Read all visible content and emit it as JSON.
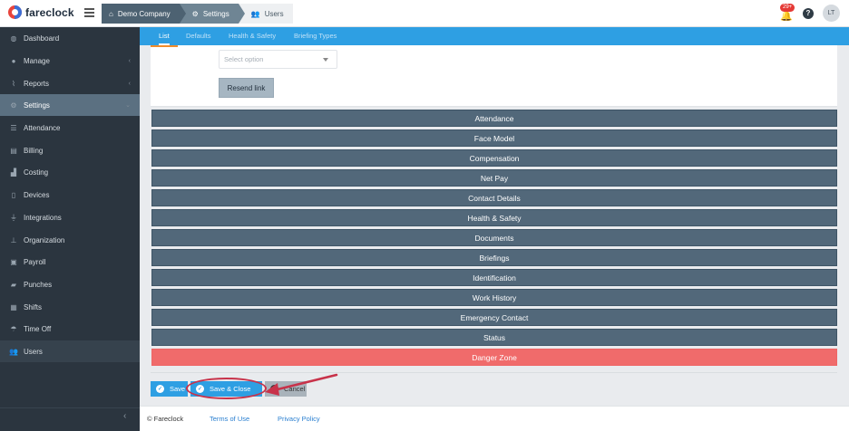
{
  "app": {
    "name": "fareclock"
  },
  "breadcrumbs": [
    {
      "label": "Demo Company",
      "icon": "home-icon"
    },
    {
      "label": "Settings",
      "icon": "gear-icon"
    },
    {
      "label": "Users",
      "icon": "users-icon"
    }
  ],
  "topbar": {
    "notification_count": "29+",
    "help": "?",
    "avatar_initials": "LT"
  },
  "sidebar": {
    "items": [
      {
        "label": "Dashboard",
        "icon": "dashboard-icon"
      },
      {
        "label": "Manage",
        "icon": "person-icon",
        "chevron": "‹"
      },
      {
        "label": "Reports",
        "icon": "chart-icon",
        "chevron": "‹"
      },
      {
        "label": "Settings",
        "icon": "gear-icon",
        "chevron": "⌄"
      },
      {
        "label": "Attendance",
        "icon": "list-icon"
      },
      {
        "label": "Billing",
        "icon": "billing-icon"
      },
      {
        "label": "Costing",
        "icon": "factory-icon"
      },
      {
        "label": "Devices",
        "icon": "tablet-icon"
      },
      {
        "label": "Integrations",
        "icon": "plug-icon"
      },
      {
        "label": "Organization",
        "icon": "sitemap-icon"
      },
      {
        "label": "Payroll",
        "icon": "money-icon"
      },
      {
        "label": "Punches",
        "icon": "truck-icon"
      },
      {
        "label": "Shifts",
        "icon": "shifts-icon"
      },
      {
        "label": "Time Off",
        "icon": "umbrella-icon"
      },
      {
        "label": "Users",
        "icon": "users-icon"
      }
    ],
    "collapse": "‹"
  },
  "tabs": [
    {
      "label": "List",
      "active": true
    },
    {
      "label": "Defaults"
    },
    {
      "label": "Health & Safety"
    },
    {
      "label": "Briefing Types"
    }
  ],
  "form": {
    "select_placeholder": "Select option",
    "resend_label": "Resend link"
  },
  "sections": [
    "Attendance",
    "Face Model",
    "Compensation",
    "Net Pay",
    "Contact Details",
    "Health & Safety",
    "Documents",
    "Briefings",
    "Identification",
    "Work History",
    "Emergency Contact",
    "Status",
    "Danger Zone"
  ],
  "actions": {
    "save": "Save",
    "save_close": "Save & Close",
    "cancel": "Cancel"
  },
  "footer": {
    "copyright": "© Fareclock",
    "terms": "Terms of Use",
    "privacy": "Privacy Policy"
  },
  "colors": {
    "accent": "#2e9fe3",
    "section": "#52687a",
    "danger": "#f06b6b",
    "sidebar": "#2b353f",
    "annotation": "#c8324a"
  }
}
